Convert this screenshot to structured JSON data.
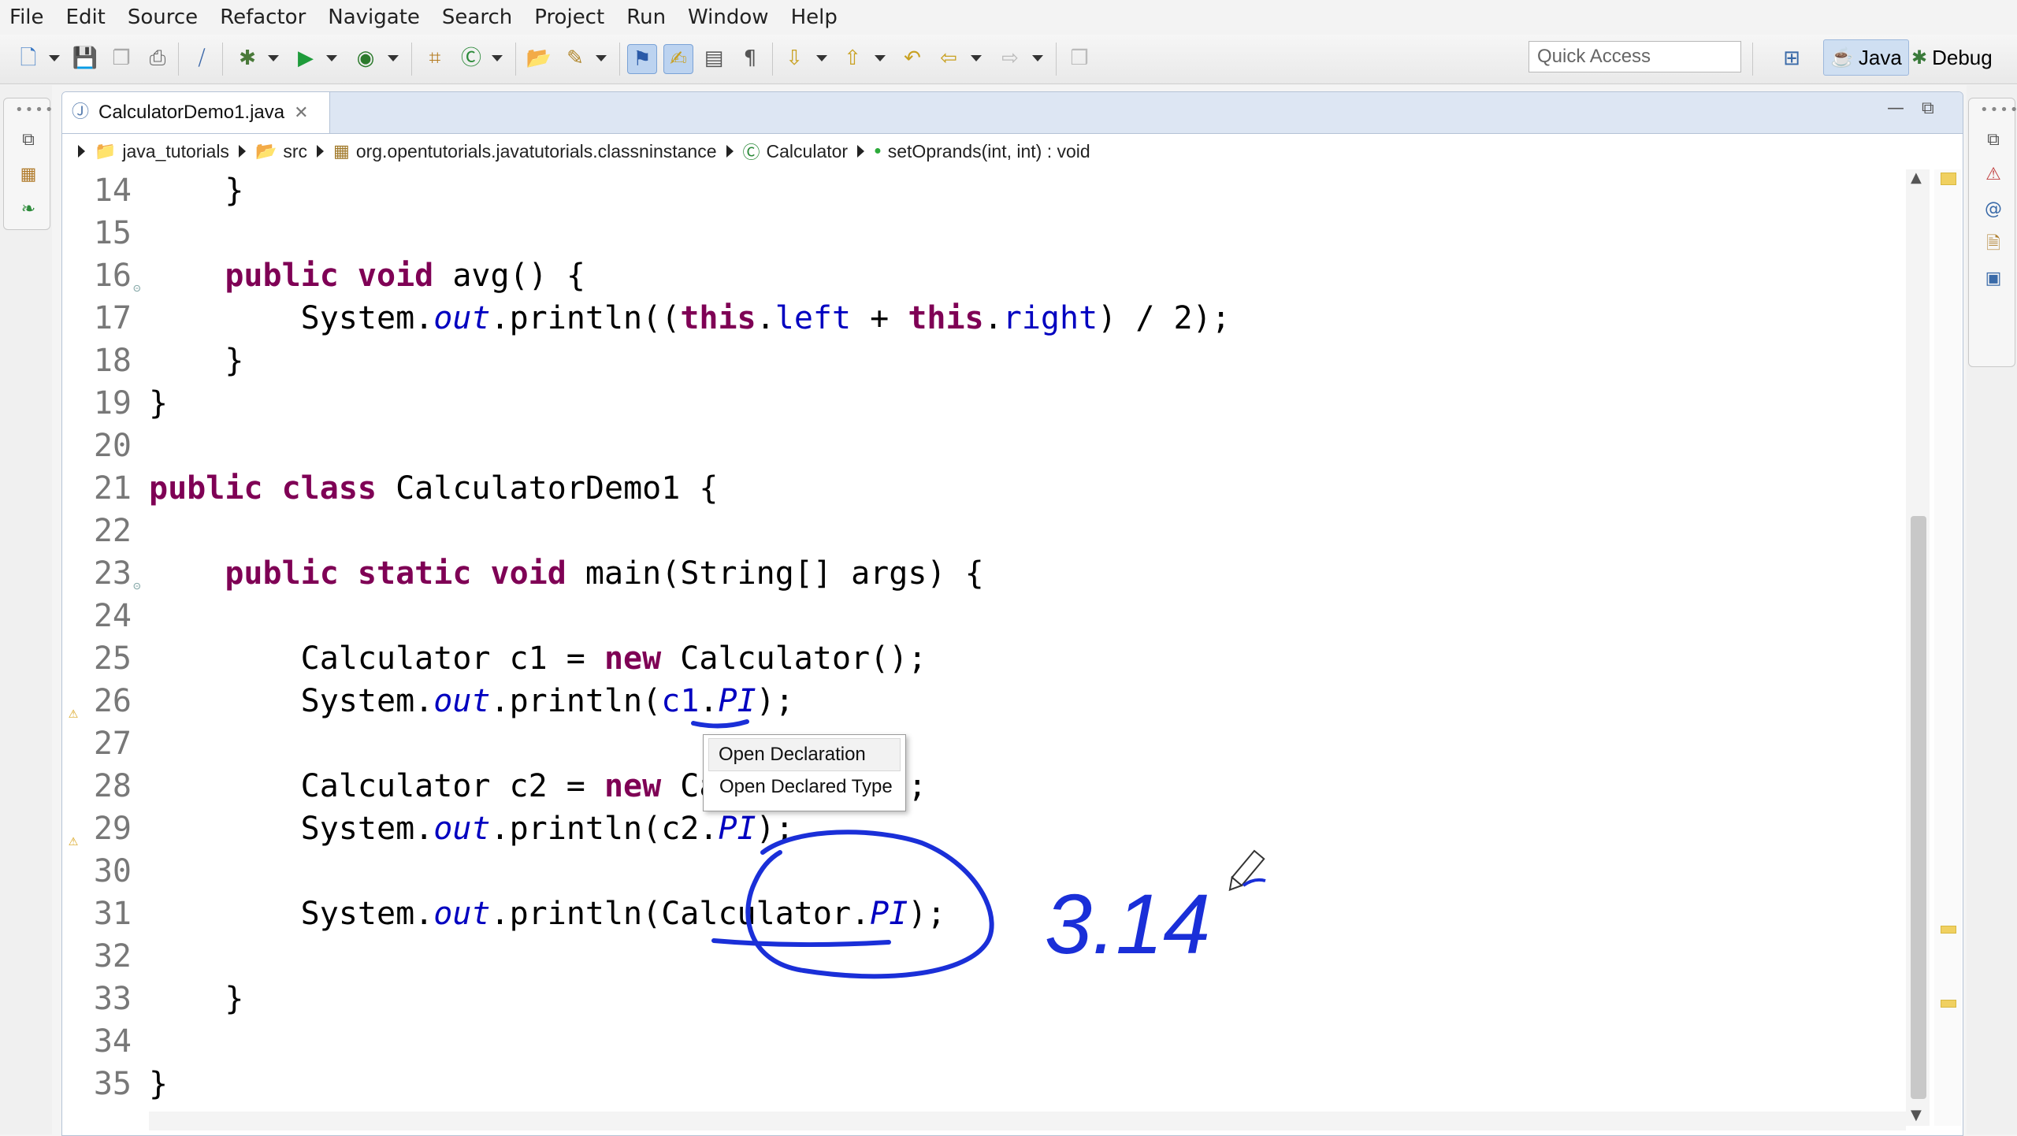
{
  "menu": [
    "File",
    "Edit",
    "Source",
    "Refactor",
    "Navigate",
    "Search",
    "Project",
    "Run",
    "Window",
    "Help"
  ],
  "toolbar": {
    "quick_access_placeholder": "Quick Access",
    "perspectives": [
      {
        "label": "Java",
        "active": true
      },
      {
        "label": "Debug",
        "active": false
      }
    ]
  },
  "editor": {
    "tab_title": "CalculatorDemo1.java",
    "breadcrumb": [
      {
        "icon": "project-icon",
        "label": "java_tutorials"
      },
      {
        "icon": "source-folder-icon",
        "label": "src"
      },
      {
        "icon": "package-icon",
        "label": "org.opentutorials.javatutorials.classninstance"
      },
      {
        "icon": "class-icon",
        "label": "Calculator"
      },
      {
        "icon": "method-icon",
        "label": "setOprands(int, int) : void"
      }
    ],
    "lines": [
      {
        "n": "14",
        "tokens": [
          [
            "t",
            "    }"
          ]
        ]
      },
      {
        "n": "15",
        "tokens": []
      },
      {
        "n": "16",
        "fold": true,
        "tokens": [
          [
            "t",
            "    "
          ],
          [
            "kw",
            "public"
          ],
          [
            "t",
            " "
          ],
          [
            "kw",
            "void"
          ],
          [
            "t",
            " avg() {"
          ]
        ]
      },
      {
        "n": "17",
        "tokens": [
          [
            "t",
            "        System."
          ],
          [
            "sfld",
            "out"
          ],
          [
            "t",
            ".println(("
          ],
          [
            "kw",
            "this"
          ],
          [
            "t",
            "."
          ],
          [
            "fld",
            "left"
          ],
          [
            "t",
            " + "
          ],
          [
            "kw",
            "this"
          ],
          [
            "t",
            "."
          ],
          [
            "fld",
            "right"
          ],
          [
            "t",
            ") / 2);"
          ]
        ]
      },
      {
        "n": "18",
        "tokens": [
          [
            "t",
            "    }"
          ]
        ]
      },
      {
        "n": "19",
        "tokens": [
          [
            "t",
            "}"
          ]
        ]
      },
      {
        "n": "20",
        "tokens": []
      },
      {
        "n": "21",
        "tokens": [
          [
            "kw",
            "public"
          ],
          [
            "t",
            " "
          ],
          [
            "kw",
            "class"
          ],
          [
            "t",
            " CalculatorDemo1 {"
          ]
        ]
      },
      {
        "n": "22",
        "tokens": []
      },
      {
        "n": "23",
        "fold": true,
        "tokens": [
          [
            "t",
            "    "
          ],
          [
            "kw",
            "public"
          ],
          [
            "t",
            " "
          ],
          [
            "kw",
            "static"
          ],
          [
            "t",
            " "
          ],
          [
            "kw",
            "void"
          ],
          [
            "t",
            " main(String[] args) {"
          ]
        ]
      },
      {
        "n": "24",
        "tokens": []
      },
      {
        "n": "25",
        "tokens": [
          [
            "t",
            "        Calculator c1 = "
          ],
          [
            "kw",
            "new"
          ],
          [
            "t",
            " Calculator();"
          ]
        ]
      },
      {
        "n": "26",
        "warn": true,
        "tokens": [
          [
            "t",
            "        System."
          ],
          [
            "sfld",
            "out"
          ],
          [
            "t",
            ".println("
          ],
          [
            "fld",
            "c1"
          ],
          [
            "t",
            "."
          ],
          [
            "sfld",
            "PI"
          ],
          [
            "t",
            ");"
          ]
        ]
      },
      {
        "n": "27",
        "tokens": []
      },
      {
        "n": "28",
        "tokens": [
          [
            "t",
            "        Calculator c2 = "
          ],
          [
            "kw",
            "new"
          ],
          [
            "t",
            " Calculator();"
          ]
        ]
      },
      {
        "n": "29",
        "warn": true,
        "tokens": [
          [
            "t",
            "        System."
          ],
          [
            "sfld",
            "out"
          ],
          [
            "t",
            ".println(c2."
          ],
          [
            "sfld",
            "PI"
          ],
          [
            "t",
            ");"
          ]
        ]
      },
      {
        "n": "30",
        "tokens": []
      },
      {
        "n": "31",
        "tokens": [
          [
            "t",
            "        System."
          ],
          [
            "sfld",
            "out"
          ],
          [
            "t",
            ".println(Calculator."
          ],
          [
            "sfld",
            "PI"
          ],
          [
            "t",
            ");"
          ]
        ]
      },
      {
        "n": "32",
        "tokens": []
      },
      {
        "n": "33",
        "tokens": [
          [
            "t",
            "    }"
          ]
        ]
      },
      {
        "n": "34",
        "tokens": []
      },
      {
        "n": "35",
        "tokens": [
          [
            "t",
            "}"
          ]
        ]
      }
    ]
  },
  "context_menu": [
    "Open Declaration",
    "Open Declared Type"
  ],
  "annotation": {
    "handwritten_text": "3.14",
    "ink_color": "#1a2fd8"
  },
  "colors": {
    "keyword": "#7f0055",
    "field": "#0000c0",
    "line_number": "#787878",
    "warning": "#d9a520"
  }
}
